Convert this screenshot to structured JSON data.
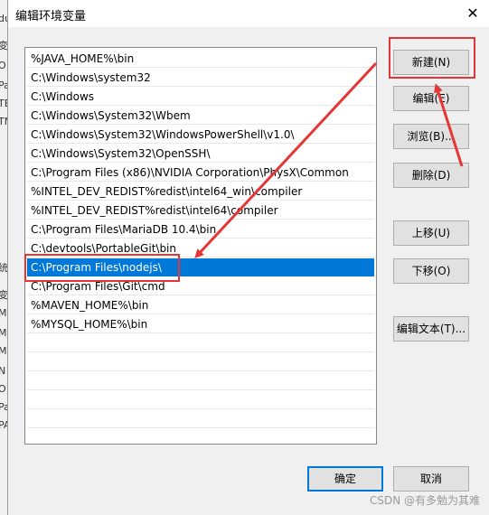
{
  "window": {
    "title": "编辑环境变量",
    "close_label": "✕"
  },
  "paths": [
    "%JAVA_HOME%\\bin",
    "C:\\Windows\\system32",
    "C:\\Windows",
    "C:\\Windows\\System32\\Wbem",
    "C:\\Windows\\System32\\WindowsPowerShell\\v1.0\\",
    "C:\\Windows\\System32\\OpenSSH\\",
    "C:\\Program Files (x86)\\NVIDIA Corporation\\PhysX\\Common",
    "%INTEL_DEV_REDIST%redist\\intel64_win\\compiler",
    "%INTEL_DEV_REDIST%redist\\intel64\\compiler",
    "C:\\Program Files\\MariaDB 10.4\\bin",
    "C:\\devtools\\PortableGit\\bin",
    "C:\\Program Files\\nodejs\\",
    "C:\\Program Files\\Git\\cmd",
    "%MAVEN_HOME%\\bin",
    "%MYSQL_HOME%\\bin"
  ],
  "selected_path": "C:\\Program Files\\nodejs\\",
  "buttons": {
    "new": "新建(N)",
    "edit": "编辑(E)",
    "browse": "浏览(B)...",
    "delete": "删除(D)",
    "move_up": "上移(U)",
    "move_down": "下移(O)",
    "edit_text": "编辑文本(T)...",
    "ok": "确定",
    "cancel": "取消"
  },
  "background_fragments": [
    "du",
    "变",
    "O",
    "Pa",
    "TE",
    "TN",
    "统",
    "变",
    "M",
    "M",
    "M",
    "N",
    "O",
    "Pa",
    "PA"
  ],
  "watermark": "CSDN @有多勉为其难",
  "colors": {
    "selection": "#0078d7",
    "annotation": "#e53535"
  }
}
